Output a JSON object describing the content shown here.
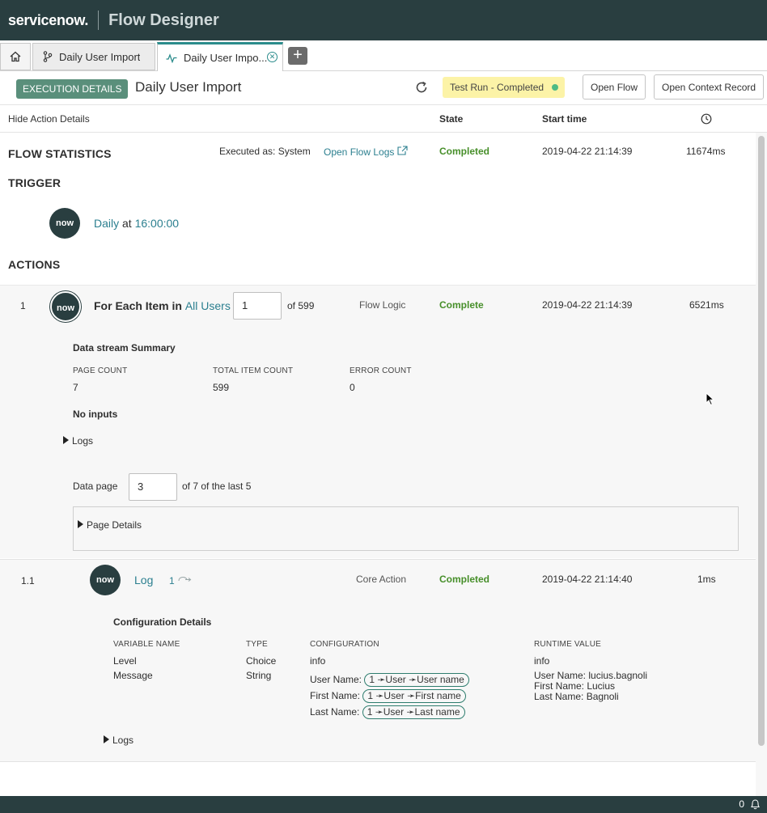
{
  "app": {
    "brand": "servicenow.",
    "product": "Flow Designer"
  },
  "tabs": [
    {
      "label": "Daily User Import"
    },
    {
      "label": "Daily User Impo..."
    }
  ],
  "header": {
    "badge": "EXECUTION DETAILS",
    "title": "Daily User Import",
    "status": "Test Run - Completed",
    "open_flow": "Open Flow",
    "open_context": "Open Context Record"
  },
  "columns": {
    "hide": "Hide Action Details",
    "state": "State",
    "start": "Start time"
  },
  "flow_stats": {
    "heading": "FLOW STATISTICS",
    "executed_as": "Executed as: System",
    "logs_link": "Open Flow Logs",
    "state": "Completed",
    "start": "2019-04-22 21:14:39",
    "duration": "11674ms"
  },
  "trigger": {
    "heading": "TRIGGER",
    "logo": "now",
    "when": "Daily",
    "at_word": "at",
    "time": "16:00:00"
  },
  "actions_heading": "ACTIONS",
  "action1": {
    "num": "1",
    "logo": "now",
    "title": "For Each Item in",
    "target": "All Users",
    "index": "1",
    "of": "of 599",
    "type": "Flow Logic",
    "state": "Complete",
    "start": "2019-04-22 21:14:39",
    "duration": "6521ms",
    "summary_heading": "Data stream Summary",
    "page_count_label": "PAGE COUNT",
    "page_count": "7",
    "total_label": "TOTAL ITEM COUNT",
    "total": "599",
    "error_label": "ERROR COUNT",
    "error": "0",
    "no_inputs": "No inputs",
    "logs": "Logs",
    "data_page_label": "Data page",
    "data_page": "3",
    "data_page_of": "of 7 of the last 5",
    "page_details": "Page Details"
  },
  "action2": {
    "num": "1.1",
    "logo": "now",
    "title": "Log",
    "link_count": "1",
    "type": "Core Action",
    "state": "Completed",
    "start": "2019-04-22 21:14:40",
    "duration": "1ms",
    "config_heading": "Configuration Details",
    "cols": {
      "var": "VARIABLE NAME",
      "type": "TYPE",
      "config": "CONFIGURATION",
      "runtime": "RUNTIME VALUE"
    },
    "rows": [
      {
        "var": "Level",
        "type": "Choice",
        "config": "info",
        "runtime": "info"
      },
      {
        "var": "Message",
        "type": "String"
      }
    ],
    "message_config": [
      {
        "label": "User Name:",
        "pill": "1 ➛User ➛User name"
      },
      {
        "label": "First Name:",
        "pill": "1 ➛User ➛First name"
      },
      {
        "label": "Last Name:",
        "pill": "1 ➛User ➛Last name"
      }
    ],
    "message_runtime": [
      "User Name: lucius.bagnoli",
      "First Name: Lucius",
      "Last Name: Bagnoli"
    ],
    "logs": "Logs"
  },
  "footer": {
    "count": "0"
  }
}
